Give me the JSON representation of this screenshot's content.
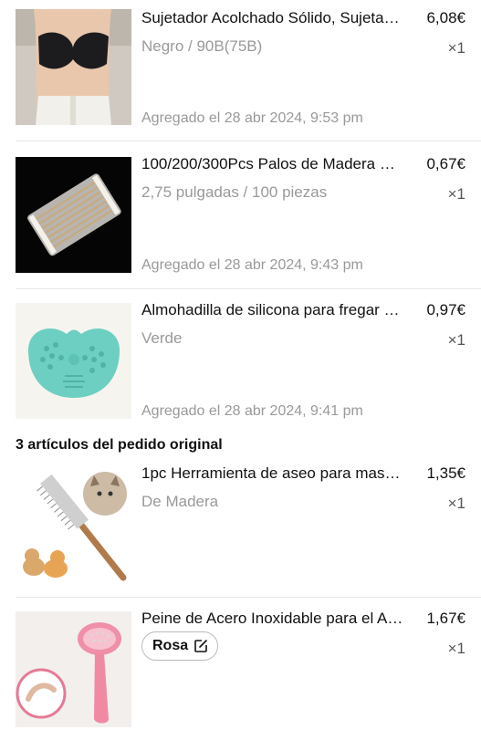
{
  "new_items": [
    {
      "title": "Sujetador Acolchado Sólido, Sujeta…",
      "price": "6,08€",
      "variant": "Negro / 90B(75B)",
      "qty": "×1",
      "added": "Agregado el 28 abr 2024, 9:53 pm",
      "image": "black-bra-photo"
    },
    {
      "title": "100/200/300Pcs Palos de Madera …",
      "price": "0,67€",
      "variant": "2,75 pulgadas / 100 piezas",
      "qty": "×1",
      "added": "Agregado el 28 abr 2024, 9:43 pm",
      "image": "wooden-sticks-bag-photo"
    },
    {
      "title": "Almohadilla de silicona para fregar …",
      "price": "0,97€",
      "variant": "Verde",
      "qty": "×1",
      "added": "Agregado el 28 abr 2024, 9:41 pm",
      "image": "green-silicone-pad-photo"
    }
  ],
  "original_section_title": "3 artículos del pedido original",
  "original_items": [
    {
      "title": "1pc Herramienta de aseo para mas…",
      "price": "1,35€",
      "variant": "De Madera",
      "qty": "×1",
      "image": "pet-grooming-comb-photo"
    },
    {
      "title": "Peine de Acero Inoxidable para el A…",
      "price": "1,67€",
      "variant": "Rosa",
      "qty": "×1",
      "image": "pink-pet-brush-photo",
      "variant_icon": "edit-icon"
    }
  ]
}
